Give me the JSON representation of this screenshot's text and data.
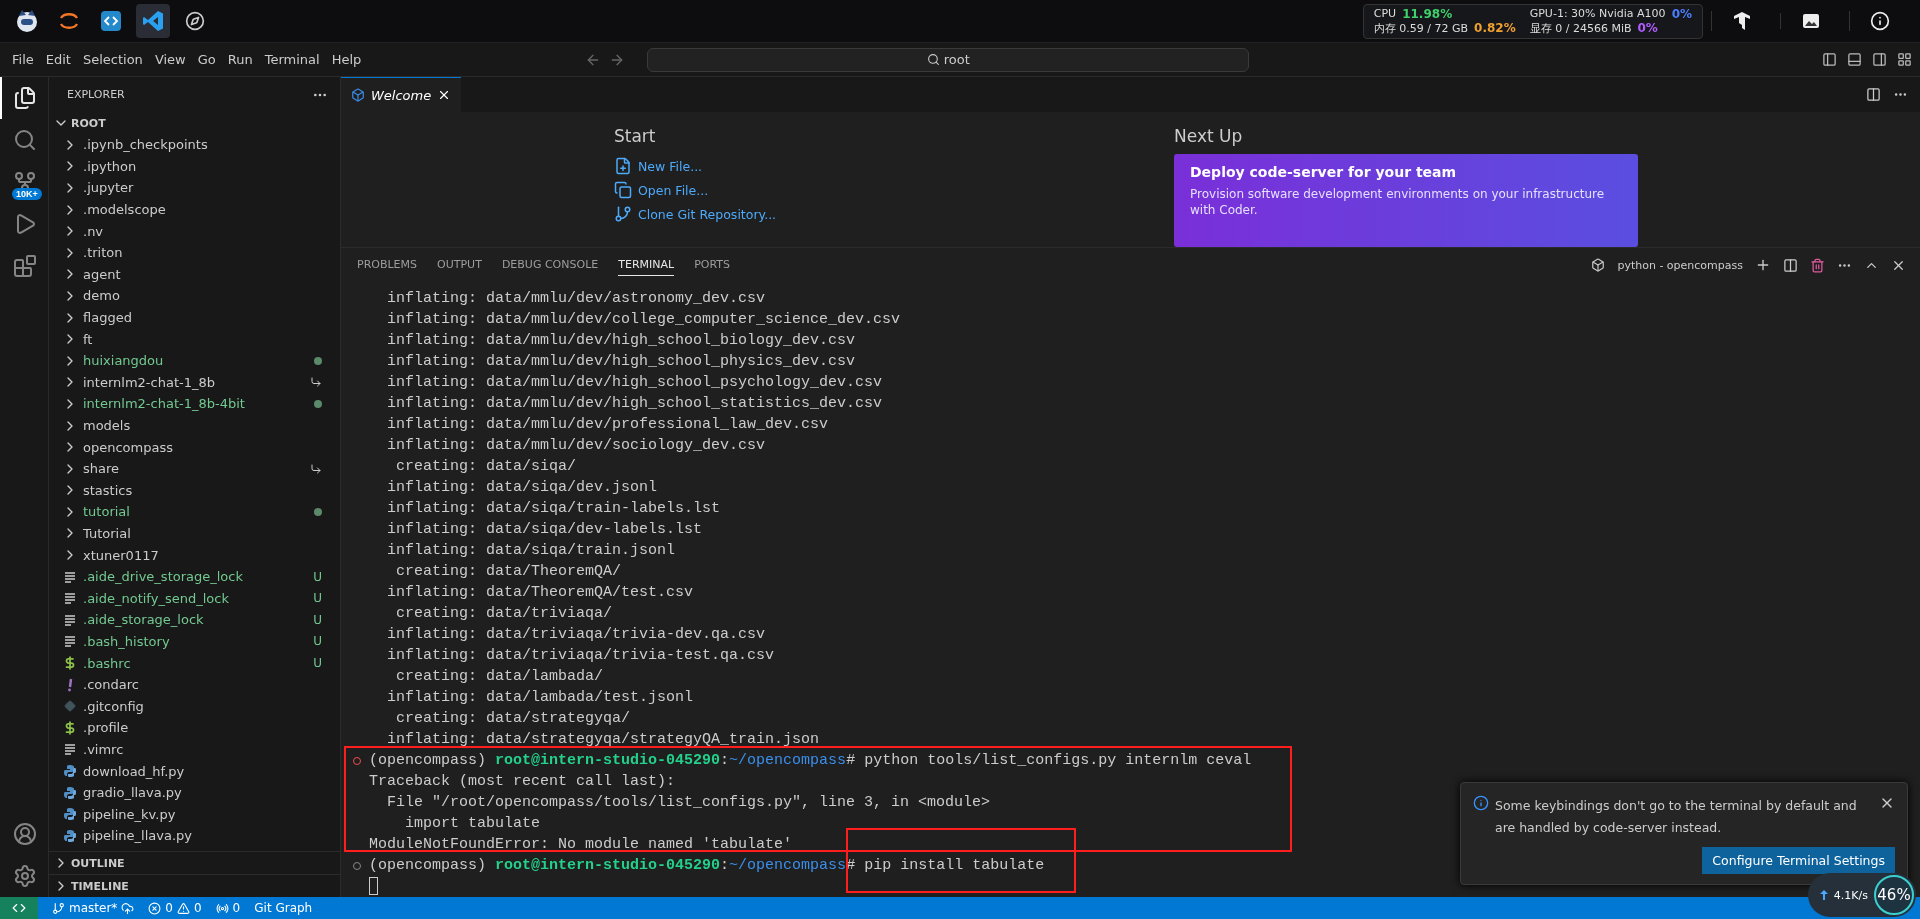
{
  "top_bar": {
    "apps": [
      {
        "kind": "logo",
        "selected": false
      },
      {
        "kind": "jupyter",
        "selected": false
      },
      {
        "kind": "code",
        "selected": false
      },
      {
        "kind": "vscode",
        "selected": true
      },
      {
        "kind": "compass",
        "selected": false
      }
    ],
    "stats": [
      {
        "label": "CPU",
        "value": "11.98%",
        "color": "#3fd16b"
      },
      {
        "label": "内存 0.59 / 72 GB",
        "value": "0.82%",
        "color": "#f0a030"
      },
      {
        "label": "GPU-1: 30% Nvidia A100",
        "value": "0%",
        "color": "#4a7dff"
      },
      {
        "label": "显存 0 / 24566 MiB",
        "value": "0%",
        "color": "#b05cff"
      }
    ]
  },
  "menu": [
    "File",
    "Edit",
    "Selection",
    "View",
    "Go",
    "Run",
    "Terminal",
    "Help"
  ],
  "search": {
    "value": "root"
  },
  "activity_bar": {
    "items": [
      {
        "kind": "explorer",
        "selected": true
      },
      {
        "kind": "search",
        "selected": false
      },
      {
        "kind": "source-control",
        "selected": false,
        "badge": "10K+"
      },
      {
        "kind": "run",
        "selected": false
      },
      {
        "kind": "extensions",
        "selected": false
      }
    ]
  },
  "explorer": {
    "title": "EXPLORER",
    "root": "ROOT",
    "items": [
      {
        "name": ".ipynb_checkpoints",
        "kind": "folder",
        "untracked": false
      },
      {
        "name": ".ipython",
        "kind": "folder",
        "untracked": false
      },
      {
        "name": ".jupyter",
        "kind": "folder",
        "untracked": false
      },
      {
        "name": ".modelscope",
        "kind": "folder",
        "untracked": false
      },
      {
        "name": ".nv",
        "kind": "folder",
        "untracked": false
      },
      {
        "name": ".triton",
        "kind": "folder",
        "untracked": false
      },
      {
        "name": "agent",
        "kind": "folder",
        "untracked": false
      },
      {
        "name": "demo",
        "kind": "folder",
        "untracked": false
      },
      {
        "name": "flagged",
        "kind": "folder",
        "untracked": false
      },
      {
        "name": "ft",
        "kind": "folder",
        "untracked": false
      },
      {
        "name": "huixiangdou",
        "kind": "folder",
        "untracked": true,
        "dot": true
      },
      {
        "name": "internlm2-chat-1_8b",
        "kind": "folder",
        "untracked": false,
        "linked": true
      },
      {
        "name": "internlm2-chat-1_8b-4bit",
        "kind": "folder",
        "untracked": true,
        "dot": true
      },
      {
        "name": "models",
        "kind": "folder",
        "untracked": false
      },
      {
        "name": "opencompass",
        "kind": "folder",
        "untracked": false
      },
      {
        "name": "share",
        "kind": "folder",
        "untracked": false,
        "linked": true
      },
      {
        "name": "stastics",
        "kind": "folder",
        "untracked": false
      },
      {
        "name": "tutorial",
        "kind": "folder",
        "untracked": true,
        "dot": true
      },
      {
        "name": "Tutorial",
        "kind": "folder",
        "untracked": false
      },
      {
        "name": "xtuner0117",
        "kind": "folder",
        "untracked": false
      },
      {
        "name": ".aide_drive_storage_lock",
        "kind": "text",
        "untracked": true,
        "badge": "U"
      },
      {
        "name": ".aide_notify_send_lock",
        "kind": "text",
        "untracked": true,
        "badge": "U"
      },
      {
        "name": ".aide_storage_lock",
        "kind": "text",
        "untracked": true,
        "badge": "U"
      },
      {
        "name": ".bash_history",
        "kind": "text",
        "untracked": true,
        "badge": "U"
      },
      {
        "name": ".bashrc",
        "kind": "shell",
        "untracked": true,
        "badge": "U"
      },
      {
        "name": ".condarc",
        "kind": "config",
        "untracked": false
      },
      {
        "name": ".gitconfig",
        "kind": "git",
        "untracked": false
      },
      {
        "name": ".profile",
        "kind": "shell",
        "untracked": false
      },
      {
        "name": ".vimrc",
        "kind": "text",
        "untracked": false
      },
      {
        "name": "download_hf.py",
        "kind": "python",
        "untracked": false
      },
      {
        "name": "gradio_llava.py",
        "kind": "python",
        "untracked": false
      },
      {
        "name": "pipeline_kv.py",
        "kind": "python",
        "untracked": false
      },
      {
        "name": "pipeline_llava.py",
        "kind": "python",
        "untracked": false
      }
    ],
    "sections": [
      {
        "title": "OUTLINE",
        "expanded": false
      },
      {
        "title": "TIMELINE",
        "expanded": false
      }
    ]
  },
  "editor_tabs": [
    {
      "label": "Welcome",
      "selected": true
    }
  ],
  "welcome": {
    "start_title": "Start",
    "actions": [
      {
        "kind": "new",
        "label": "New File..."
      },
      {
        "kind": "open",
        "label": "Open File..."
      },
      {
        "kind": "clone",
        "label": "Clone Git Repository..."
      }
    ],
    "next_title": "Next Up",
    "card": {
      "title": "Deploy code-server for your team",
      "body": "Provision software development environments on your infrastructure with Coder."
    }
  },
  "panel": {
    "tabs": [
      {
        "label": "PROBLEMS",
        "selected": false
      },
      {
        "label": "OUTPUT",
        "selected": false
      },
      {
        "label": "DEBUG CONSOLE",
        "selected": false
      },
      {
        "label": "TERMINAL",
        "selected": true
      },
      {
        "label": "PORTS",
        "selected": false
      }
    ],
    "terminal_name": "python - opencompass"
  },
  "terminal": [
    {
      "kind": "output",
      "text": "  inflating: data/mmlu/dev/astronomy_dev.csv"
    },
    {
      "kind": "output",
      "text": "  inflating: data/mmlu/dev/college_computer_science_dev.csv"
    },
    {
      "kind": "output",
      "text": "  inflating: data/mmlu/dev/high_school_biology_dev.csv"
    },
    {
      "kind": "output",
      "text": "  inflating: data/mmlu/dev/high_school_physics_dev.csv"
    },
    {
      "kind": "output",
      "text": "  inflating: data/mmlu/dev/high_school_psychology_dev.csv"
    },
    {
      "kind": "output",
      "text": "  inflating: data/mmlu/dev/high_school_statistics_dev.csv"
    },
    {
      "kind": "output",
      "text": "  inflating: data/mmlu/dev/professional_law_dev.csv"
    },
    {
      "kind": "output",
      "text": "  inflating: data/mmlu/dev/sociology_dev.csv"
    },
    {
      "kind": "output",
      "text": "   creating: data/siqa/"
    },
    {
      "kind": "output",
      "text": "  inflating: data/siqa/dev.jsonl"
    },
    {
      "kind": "output",
      "text": "  inflating: data/siqa/train-labels.lst"
    },
    {
      "kind": "output",
      "text": "  inflating: data/siqa/dev-labels.lst"
    },
    {
      "kind": "output",
      "text": "  inflating: data/siqa/train.jsonl"
    },
    {
      "kind": "output",
      "text": "   creating: data/TheoremQA/"
    },
    {
      "kind": "output",
      "text": "  inflating: data/TheoremQA/test.csv"
    },
    {
      "kind": "output",
      "text": "   creating: data/triviaqa/"
    },
    {
      "kind": "output",
      "text": "  inflating: data/triviaqa/trivia-dev.qa.csv"
    },
    {
      "kind": "output",
      "text": "  inflating: data/triviaqa/trivia-test.qa.csv"
    },
    {
      "kind": "output",
      "text": "   creating: data/lambada/"
    },
    {
      "kind": "output",
      "text": "  inflating: data/lambada/test.jsonl"
    },
    {
      "kind": "output",
      "text": "   creating: data/strategyqa/"
    },
    {
      "kind": "output",
      "text": "  inflating: data/strategyqa/strategyQA_train.json"
    },
    {
      "kind": "prompt",
      "failed": true,
      "env": "(opencompass)",
      "user": "root@intern-studio-045290",
      "separator": ":",
      "path": "~/opencompass",
      "symbol": "#",
      "command": "python tools/list_configs.py internlm ceval"
    },
    {
      "kind": "output",
      "text": "Traceback (most recent call last):"
    },
    {
      "kind": "output",
      "text": "  File \"/root/opencompass/tools/list_configs.py\", line 3, in <module>"
    },
    {
      "kind": "output",
      "text": "    import tabulate"
    },
    {
      "kind": "output",
      "text": "ModuleNotFoundError: No module named 'tabulate'"
    },
    {
      "kind": "prompt",
      "failed": false,
      "env": "(opencompass)",
      "user": "root@intern-studio-045290",
      "separator": ":",
      "path": "~/opencompass",
      "symbol": "#",
      "command": "pip install tabulate"
    },
    {
      "kind": "cursor"
    }
  ],
  "notification": {
    "message": "Some keybindings don't go to the terminal by default and are handled by code-server instead.",
    "button": "Configure Terminal Settings"
  },
  "speed_widget": {
    "upload": "4.1K/s",
    "percent": "46",
    "unit": "%"
  },
  "status_bar": {
    "branch": "master*",
    "errors": "0",
    "warnings": "0",
    "ports": "0",
    "git_graph": "Git Graph"
  }
}
